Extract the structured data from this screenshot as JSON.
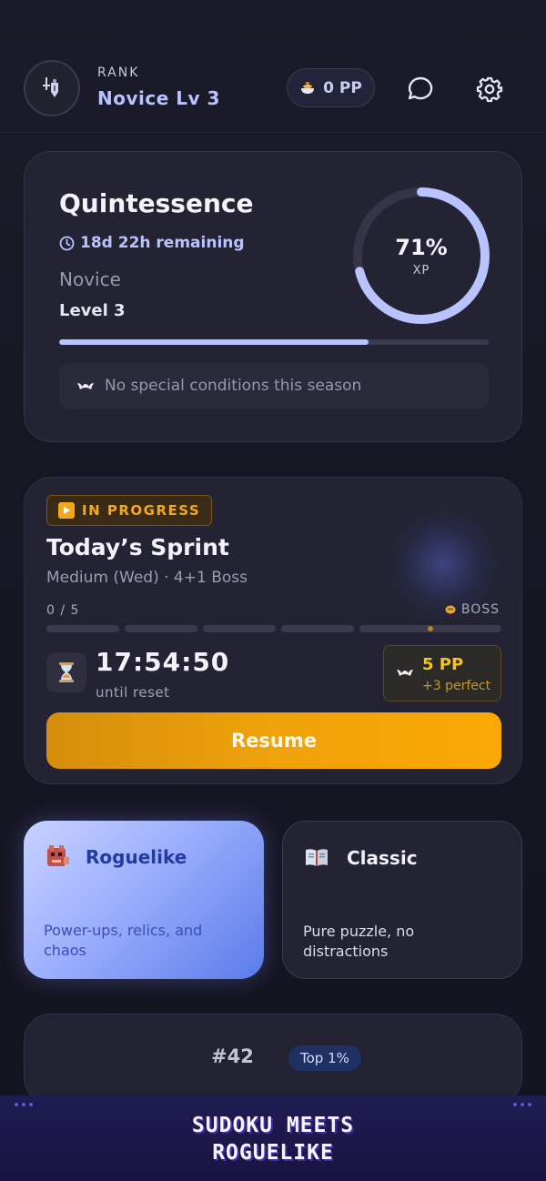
{
  "header": {
    "rank_label": "RANK",
    "rank_value": "Novice  Lv 3",
    "pp_value": "0 PP",
    "avatar_icon": "knight-icon",
    "pp_icon": "cauldron-icon",
    "chat_icon": "chat-icon",
    "settings_icon": "gear-icon"
  },
  "season": {
    "title": "Quintessence",
    "remaining": "18d 22h remaining",
    "tier": "Novice",
    "level": "Level 3",
    "xp_percent_label": "71%",
    "xp_label": "XP",
    "xp_fraction": 0.71,
    "level_progress_fraction": 0.72,
    "conditions": "No special conditions this season"
  },
  "sprint": {
    "status": "IN PROGRESS",
    "title": "Today’s Sprint",
    "subtitle": "Medium (Wed) · 4+1 Boss",
    "progress": "0 / 5",
    "boss_label": "BOSS",
    "timer": "17:54:50",
    "timer_sub": "until reset",
    "reward_pp": "5 PP",
    "reward_bonus": "+3 perfect",
    "resume_label": "Resume"
  },
  "modes": {
    "roguelike": {
      "title": "Roguelike",
      "desc": "Power-ups, relics, and chaos",
      "icon": "dragon-icon"
    },
    "classic": {
      "title": "Classic",
      "desc": "Pure puzzle, no distractions",
      "icon": "book-icon"
    }
  },
  "leaderboard": {
    "rank": "#42",
    "badge": "Top 1%"
  },
  "banner": {
    "line1": "SUDOKU MEETS",
    "line2": "ROGUELIKE"
  },
  "colors": {
    "accent": "#b9c3ff",
    "orange": "#f4a91c",
    "background": "#15151f",
    "card": "#232333"
  }
}
